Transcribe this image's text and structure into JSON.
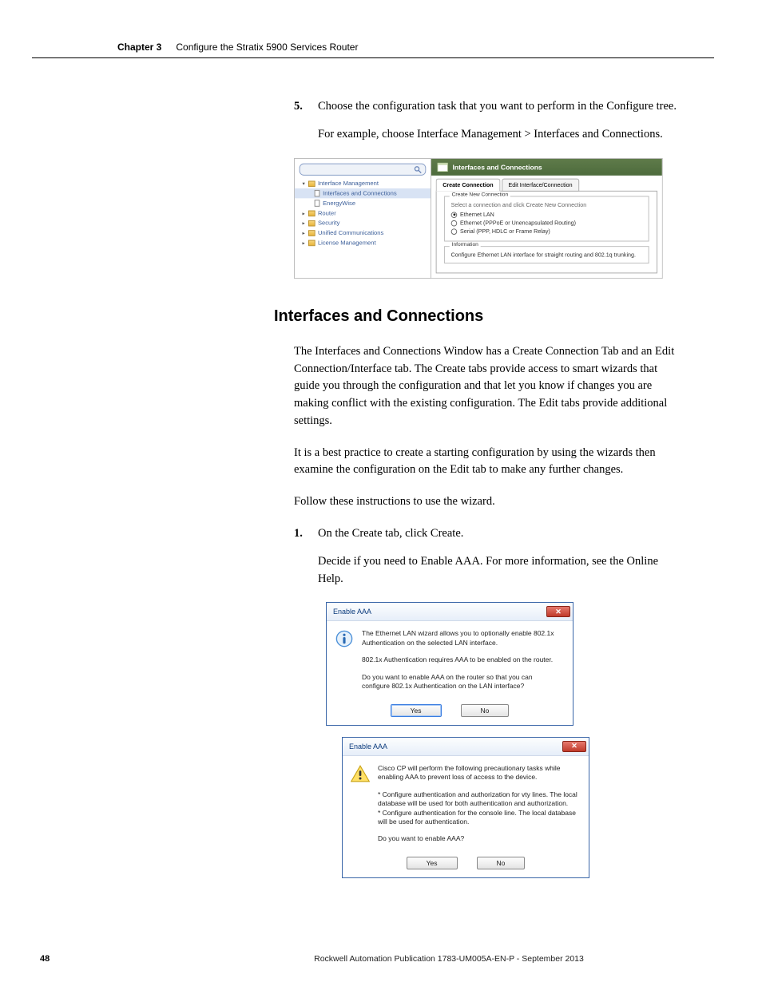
{
  "header": {
    "chapter": "Chapter 3",
    "title": "Configure the Stratix 5900 Services Router"
  },
  "step5": {
    "num": "5.",
    "text": "Choose the configuration task that you want to perform in the Configure tree.",
    "example": "For example, choose Interface Management > Interfaces and Connections."
  },
  "mini1": {
    "tree": {
      "top": "Interface Management",
      "selected": "Interfaces and Connections",
      "sub2": "EnergyWise",
      "items": [
        "Router",
        "Security",
        "Unified Communications",
        "License Management"
      ]
    },
    "panel": {
      "title": "Interfaces and Connections",
      "tab1": "Create Connection",
      "tab2": "Edit Interface/Connection",
      "fs1": {
        "legend": "Create New Connection",
        "hint": "Select a connection and click Create New Connection",
        "r1": "Ethernet LAN",
        "r2": "Ethernet (PPPoE or Unencapsulated Routing)",
        "r3": "Serial (PPP, HDLC or Frame Relay)"
      },
      "fs2": {
        "legend": "Information",
        "text": "Configure Ethernet LAN interface for straight routing and 802.1q trunking."
      }
    }
  },
  "section": {
    "heading": "Interfaces and Connections",
    "p1": "The Interfaces and Connections Window has a Create Connection Tab and an Edit Connection/Interface tab. The Create tabs provide access to smart wizards that guide you through the configuration and that let you know if changes you are making conflict with the existing configuration. The Edit tabs provide additional settings.",
    "p2": "It is a best practice to create a starting configuration by using the wizards then examine the configuration on the Edit tab to make any further changes.",
    "p3": "Follow these instructions to use the wizard."
  },
  "step1": {
    "num": "1.",
    "text": "On the Create tab, click Create.",
    "sub": "Decide if you need to Enable AAA. For more information, see the Online Help."
  },
  "dialog1": {
    "title": "Enable AAA",
    "p1": "The Ethernet LAN wizard allows you to optionally enable 802.1x Authentication on the selected LAN interface.",
    "p2": "802.1x Authentication requires AAA to be enabled on the router.",
    "p3": "Do you want to enable AAA on the router so that you can configure 802.1x Authentication on the LAN interface?",
    "yes": "Yes",
    "no": "No"
  },
  "dialog2": {
    "title": "Enable AAA",
    "p1": "Cisco CP will perform the following precautionary tasks while enabling AAA to prevent loss of access to the device.",
    "p2": "* Configure authentication and authorization for vty lines. The local database will be used for both authentication and authorization.\n* Configure authentication for the console line. The local database will be used for authentication.",
    "p3": "Do you want to enable AAA?",
    "yes": "Yes",
    "no": "No"
  },
  "footer": {
    "page": "48",
    "pub": "Rockwell Automation Publication 1783-UM005A-EN-P - September 2013"
  }
}
